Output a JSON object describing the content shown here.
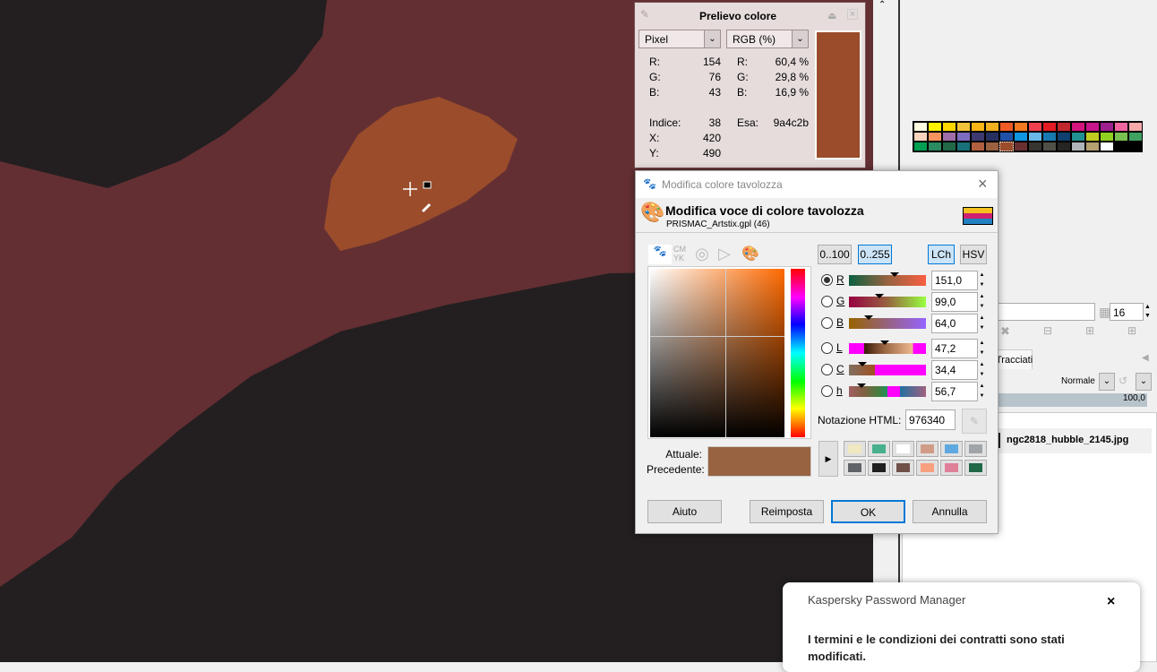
{
  "canvas": {
    "colors": {
      "dark": "#231f20",
      "maroon": "#632f33",
      "orange": "#9a4c2b"
    }
  },
  "picker": {
    "title": "Prelievo colore",
    "mode": "Pixel",
    "color_model": "RGB (%)",
    "left": [
      {
        "k": "R:",
        "v": "154"
      },
      {
        "k": "G:",
        "v": "76"
      },
      {
        "k": "B:",
        "v": "43"
      }
    ],
    "right": [
      {
        "k": "R:",
        "v": "60,4 %"
      },
      {
        "k": "G:",
        "v": "29,8 %"
      },
      {
        "k": "B:",
        "v": "16,9 %"
      }
    ],
    "index_label": "Indice:",
    "index": "38",
    "hex_label": "Esa:",
    "hex": "9a4c2b",
    "x_label": "X:",
    "x": "420",
    "y_label": "Y:",
    "y": "490",
    "swatch": "#9a4c2b"
  },
  "dialog": {
    "window_title": "Modifica colore tavolozza",
    "heading": "Modifica voce di colore tavolozza",
    "subtitle": "PRISMAC_Artstix.gpl (46)",
    "range_buttons": [
      "0..100",
      "0..255"
    ],
    "model_buttons": [
      "LCh",
      "HSV"
    ],
    "channels": [
      {
        "label": "R",
        "value": "151,0",
        "pos": 0.59,
        "grad": "linear-gradient(90deg,#0a6040,#976340,#f86040)"
      },
      {
        "label": "G",
        "value": "99,0",
        "pos": 0.39,
        "grad": "linear-gradient(90deg,#970040,#976340,#97ff40)"
      },
      {
        "label": "B",
        "value": "64,0",
        "pos": 0.25,
        "grad": "linear-gradient(90deg,#976300,#976380,#9763ff)"
      },
      {
        "label": "L",
        "value": "47,2",
        "pos": 0.47,
        "grad": "linear-gradient(90deg,#ff00ff 0 20%,#3a1a08 20%,#976340 45%,#f0b890 83%,#ff00ff 83%)"
      },
      {
        "label": "C",
        "value": "34,4",
        "pos": 0.17,
        "grad": "linear-gradient(90deg,#807060,#a05020 34%,#ff00ff 34%)"
      },
      {
        "label": "h",
        "value": "56,7",
        "pos": 0.16,
        "grad": "linear-gradient(90deg,#a06060,#806040 20%,#408040 40%,#209060 50%,#ff00ff 50%,#ff00ff 66%,#2070a0 66%,#a06080)"
      }
    ],
    "html_label": "Notazione HTML:",
    "html_value": "976340",
    "current_label": "Attuale:",
    "previous_label": "Precedente:",
    "current_color": "#976340",
    "history": [
      "#f0e8c0",
      "#48b08c",
      "#ffffff",
      "#d09c88",
      "#60a8e0",
      "#a0a4a8",
      "#606468",
      "#202020",
      "#705048",
      "#f8a080",
      "#e08098",
      "#206848"
    ],
    "buttons": {
      "help": "Aiuto",
      "reset": "Reimposta",
      "ok": "OK",
      "cancel": "Annulla"
    }
  },
  "palette": {
    "colors": [
      "#fffbe0",
      "#fff200",
      "#ffd700",
      "#f2c23a",
      "#fbb516",
      "#f0b020",
      "#f15a24",
      "#f47920",
      "#ef4050",
      "#e31b23",
      "#c1272d",
      "#d4157e",
      "#c7158a",
      "#9e1f8e",
      "#f065a0",
      "#f7aaaa",
      "#fdd5be",
      "#f7945e",
      "#a06ea6",
      "#7e6cc0",
      "#3e3a70",
      "#263060",
      "#2050a8",
      "#1095e0",
      "#68b8e8",
      "#1878b0",
      "#0e4070",
      "#209090",
      "#c0cc20",
      "#90d020",
      "#78c050",
      "#40a060",
      "#00a050",
      "#2a8a60",
      "#206848",
      "#187078",
      "#b06040",
      "#9a6040",
      "#9a4c2b",
      "#6a3030",
      "#383430",
      "#505048",
      "#282424",
      "#b0b4b8",
      "#b4a070",
      "#ffffff",
      "#000000",
      "#000000"
    ],
    "columns": "16"
  },
  "layers": {
    "tab": "Tracciati",
    "mode": "Normale",
    "opacity": "100,0",
    "layer_name": "ngc2818_hubble_2145.jpg"
  },
  "notification": {
    "app": "Kaspersky Password Manager",
    "message": "I termini e le condizioni dei contratti sono stati modificati.",
    "close": "×"
  }
}
